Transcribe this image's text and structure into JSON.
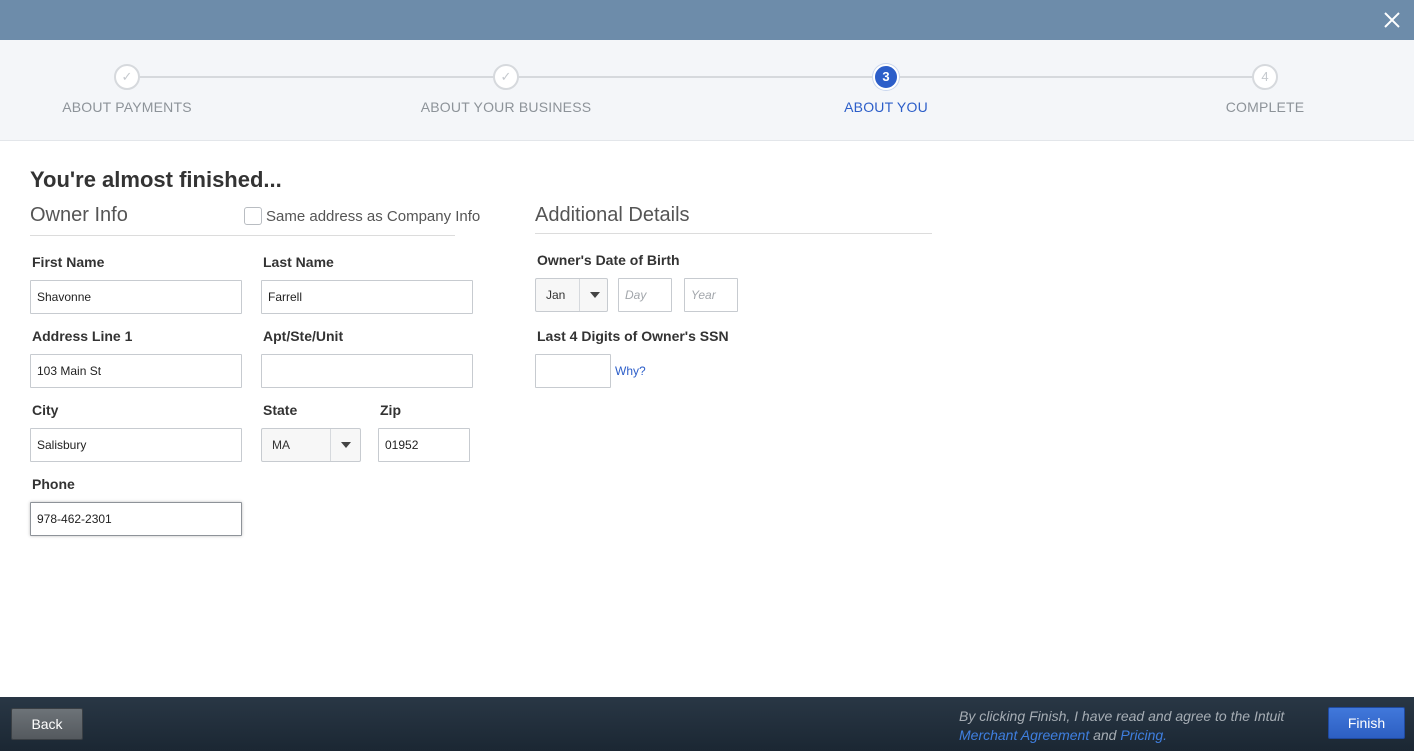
{
  "stepper": {
    "steps": [
      {
        "label": "ABOUT PAYMENTS",
        "marker": "✓",
        "state": "done"
      },
      {
        "label": "ABOUT YOUR BUSINESS",
        "marker": "✓",
        "state": "done"
      },
      {
        "label": "ABOUT YOU",
        "marker": "3",
        "state": "active"
      },
      {
        "label": "COMPLETE",
        "marker": "4",
        "state": "pending"
      }
    ]
  },
  "page": {
    "heading": "You're almost finished..."
  },
  "owner_info": {
    "title": "Owner Info",
    "same_address_label": "Same address as Company Info",
    "same_address_checked": false,
    "first_name": {
      "label": "First Name",
      "value": "Shavonne"
    },
    "last_name": {
      "label": "Last Name",
      "value": "Farrell"
    },
    "address1": {
      "label": "Address Line 1",
      "value": "103 Main St"
    },
    "apt": {
      "label": "Apt/Ste/Unit",
      "value": ""
    },
    "city": {
      "label": "City",
      "value": "Salisbury"
    },
    "state": {
      "label": "State",
      "value": "MA"
    },
    "zip": {
      "label": "Zip",
      "value": "01952"
    },
    "phone": {
      "label": "Phone",
      "value": "978-462-2301"
    }
  },
  "additional": {
    "title": "Additional Details",
    "dob_label": "Owner's Date of Birth",
    "dob_month": "Jan",
    "dob_day_placeholder": "Day",
    "dob_year_placeholder": "Year",
    "ssn_label": "Last 4 Digits of Owner's SSN",
    "ssn_value": "",
    "why_link": "Why?"
  },
  "footer": {
    "back_label": "Back",
    "agree_prefix": "By clicking Finish, I have read and agree to the Intuit",
    "merchant_link": "Merchant Agreement",
    "and_text": "and",
    "pricing_link": "Pricing",
    "period": ".",
    "finish_label": "Finish"
  },
  "colors": {
    "topbar": "#6d8caa",
    "accent": "#2c5ec9",
    "footer": "#1b2733"
  }
}
